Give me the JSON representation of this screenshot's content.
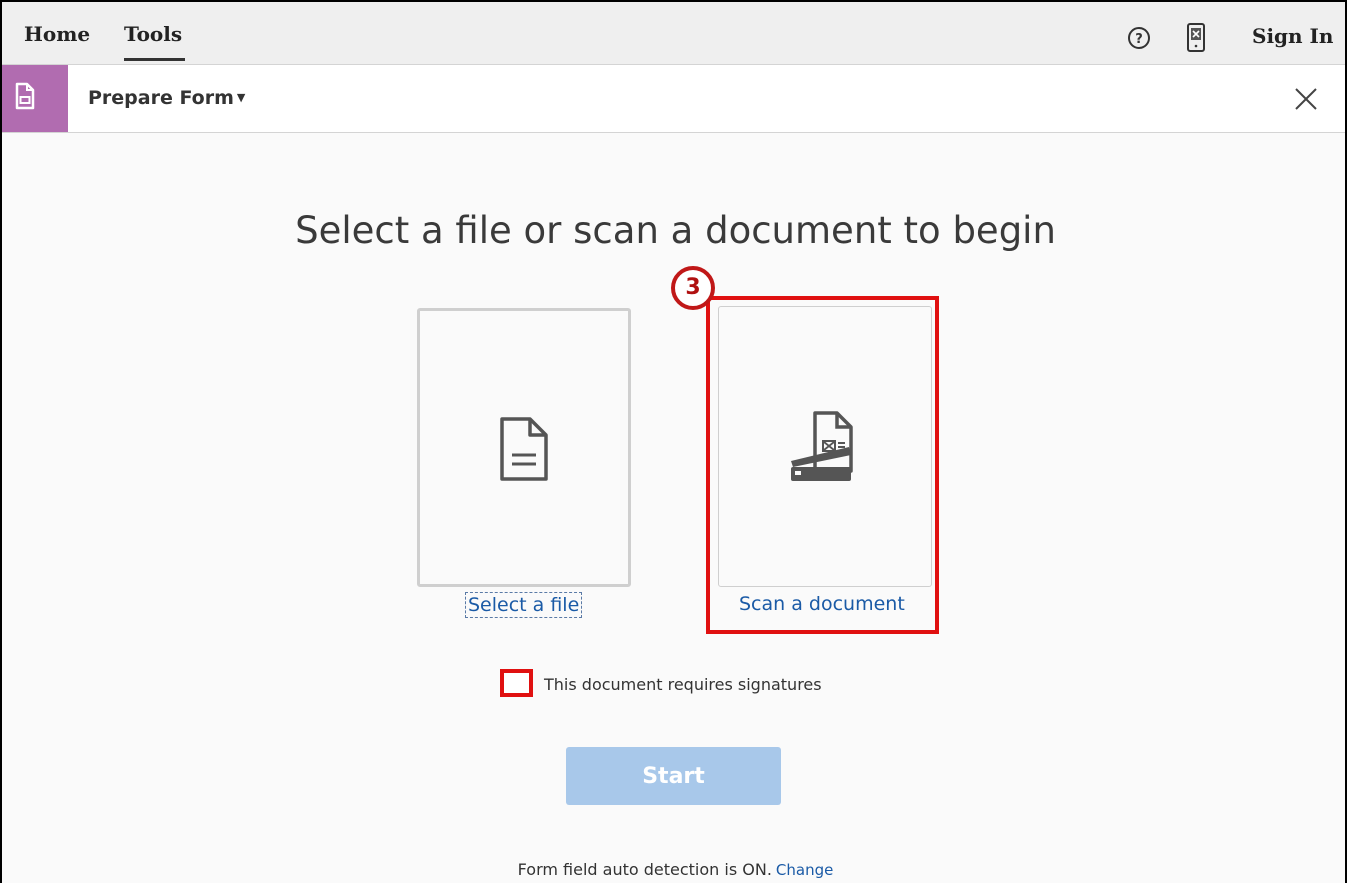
{
  "nav": {
    "home_label": "Home",
    "tools_label": "Tools",
    "help_icon": "help-circle-icon",
    "mobile_icon": "mobile-link-icon",
    "signin_label": "Sign In"
  },
  "tool": {
    "name": "Prepare Form",
    "icon": "prepare-form-icon",
    "close_icon": "close-icon",
    "accent_color": "#b16cb0"
  },
  "main": {
    "heading": "Select a file or scan a document to begin",
    "select_file_label": "Select a file",
    "scan_document_label": "Scan a document",
    "signatures_label": "This document requires signatures",
    "signatures_checked": false,
    "start_label": "Start",
    "footer_text": "Form field auto detection is ON.",
    "footer_link": "Change"
  },
  "annotation": {
    "step_number": "3",
    "highlight_color": "#e01010"
  }
}
